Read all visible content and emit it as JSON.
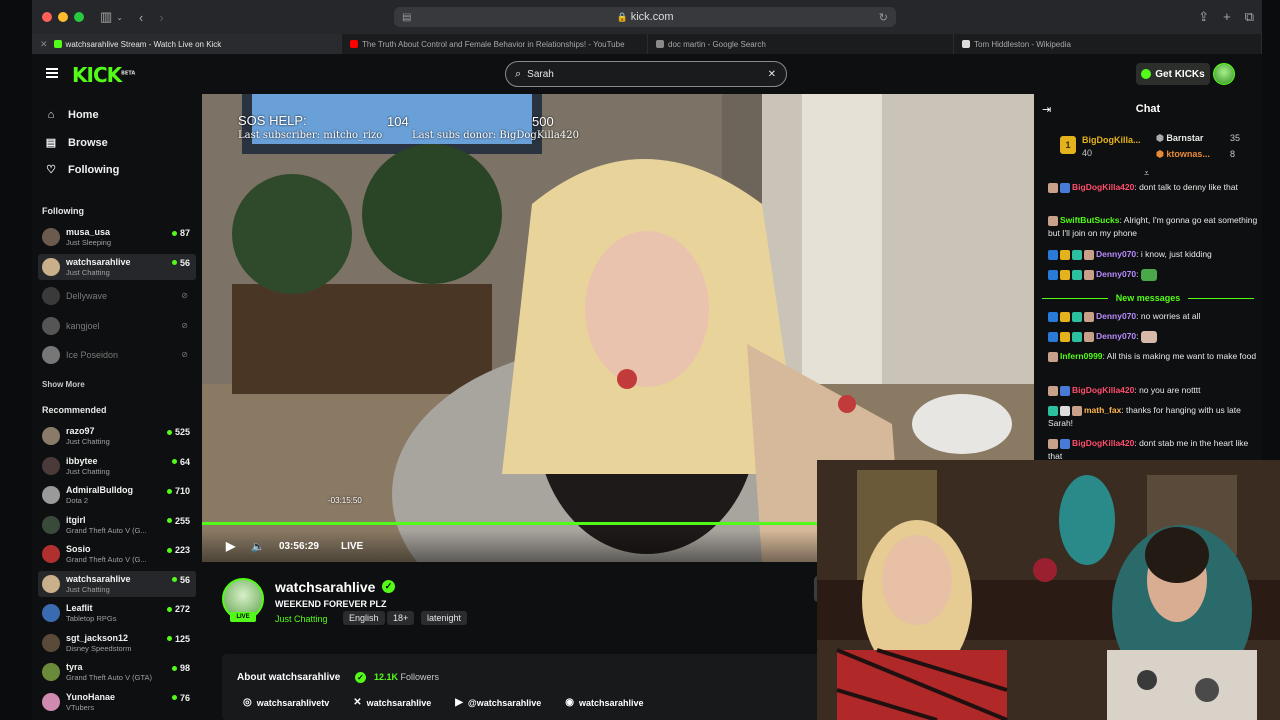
{
  "browser": {
    "url": "kick.com",
    "tabs": [
      {
        "title": "watchsarahlive Stream - Watch Live on Kick",
        "active": true,
        "fav_color": "#53fc18"
      },
      {
        "title": "The Truth About Control and Female Behavior in Relationships! - YouTube",
        "active": false,
        "fav_color": "#ff0000"
      },
      {
        "title": "doc martin - Google Search",
        "active": false,
        "fav_color": "#8a8a8a"
      },
      {
        "title": "Tom Hiddleston - Wikipedia",
        "active": false,
        "fav_color": "#dddddd"
      }
    ]
  },
  "header": {
    "logo": "KICK",
    "logo_sup": "BETA",
    "search_value": "Sarah",
    "get_kicks": "Get KICKs"
  },
  "nav": {
    "home": "Home",
    "browse": "Browse",
    "following": "Following"
  },
  "following": {
    "title": "Following",
    "channels": [
      {
        "name": "musa_usa",
        "sub": "Just Sleeping",
        "viewers": "87",
        "live": true,
        "active": false,
        "av": "#6b5a4e"
      },
      {
        "name": "watchsarahlive",
        "sub": "Just Chatting",
        "viewers": "56",
        "live": true,
        "active": true,
        "av": "#c9b08a"
      },
      {
        "name": "Dellywave",
        "sub": "",
        "viewers": "",
        "live": false,
        "active": false,
        "av": "#3a3a3a"
      },
      {
        "name": "kangjoel",
        "sub": "",
        "viewers": "",
        "live": false,
        "active": false,
        "av": "#555555"
      },
      {
        "name": "Ice Poseidon",
        "sub": "",
        "viewers": "",
        "live": false,
        "active": false,
        "av": "#777777"
      }
    ],
    "show_more": "Show More"
  },
  "recommended": {
    "title": "Recommended",
    "channels": [
      {
        "name": "razo97",
        "sub": "Just Chatting",
        "viewers": "525",
        "active": false,
        "av": "#8a7a6a"
      },
      {
        "name": "ibbytee",
        "sub": "Just Chatting",
        "viewers": "64",
        "active": false,
        "av": "#4a3a3a"
      },
      {
        "name": "AdmiralBulldog",
        "sub": "Dota 2",
        "viewers": "710",
        "active": false,
        "av": "#9a9a9a"
      },
      {
        "name": "itgirl",
        "sub": "Grand Theft Auto V (G...",
        "viewers": "255",
        "active": false,
        "av": "#3a4a3a"
      },
      {
        "name": "Sosio",
        "sub": "Grand Theft Auto V (G...",
        "viewers": "223",
        "active": false,
        "av": "#b03030"
      },
      {
        "name": "watchsarahlive",
        "sub": "Just Chatting",
        "viewers": "56",
        "active": true,
        "av": "#c9b08a"
      },
      {
        "name": "Leaflit",
        "sub": "Tabletop RPGs",
        "viewers": "272",
        "active": false,
        "av": "#3a6ab0"
      },
      {
        "name": "sgt_jackson12",
        "sub": "Disney Speedstorm",
        "viewers": "125",
        "active": false,
        "av": "#5a4a3a"
      },
      {
        "name": "tyra",
        "sub": "Grand Theft Auto V (GTA)",
        "viewers": "98",
        "active": false,
        "av": "#6a8a3a"
      },
      {
        "name": "YunoHanae",
        "sub": "VTubers",
        "viewers": "76",
        "active": false,
        "av": "#d08ab0"
      }
    ]
  },
  "video": {
    "overlay_sos": "SOS HELP:",
    "overlay_count": "104",
    "overlay_goal": "500",
    "overlay_last_sub": "Last subscriber: mitcho_rizo",
    "overlay_last_donor": "Last subs donor: BigDogKilla420",
    "progress_hover_time": "-03:15:50",
    "elapsed": "03:56:29",
    "live_label": "LIVE",
    "progress_percent": 100
  },
  "stream": {
    "name": "watchsarahlive",
    "title": "WEEKEND FOREVER PLZ",
    "category": "Just Chatting",
    "tags": [
      "English",
      "18+",
      "latenight"
    ],
    "live_badge": "LIVE"
  },
  "about": {
    "title": "About watchsarahlive",
    "followers_count": "12.1K",
    "followers_label": "Followers",
    "socials": [
      {
        "icon": "instagram-icon",
        "glyph": "◎",
        "label": "watchsarahlivetv"
      },
      {
        "icon": "x-twitter-icon",
        "glyph": "✕",
        "label": "watchsarahlive"
      },
      {
        "icon": "youtube-icon",
        "glyph": "▶",
        "label": "@watchsarahlive"
      },
      {
        "icon": "discord-icon",
        "glyph": "◉",
        "label": "watchsarahlive"
      }
    ]
  },
  "chat": {
    "title": "Chat",
    "leaderboard": {
      "first_name": "BigDogKilla...",
      "first_value": "40",
      "second_name": "Barnstar",
      "second_value": "35",
      "third_name": "ktownas...",
      "third_value": "8",
      "rank": "1"
    },
    "new_messages_label": "New messages",
    "messages": [
      {
        "user": "BigDogKilla420",
        "color": "#ff4d6d",
        "text": ": dont talk to denny like that"
      },
      {
        "user": "SwiftButSucks",
        "color": "#53fc18",
        "text": ": Alright, I'm gonna go eat something but I'll join on my phone"
      },
      {
        "user": "Denny070",
        "color": "#b98cff",
        "text": ": i know, just kidding"
      },
      {
        "user": "Denny070",
        "color": "#b98cff",
        "text": ": "
      },
      {
        "user": "Denny070",
        "color": "#b98cff",
        "text": ": no worries at all"
      },
      {
        "user": "Denny070",
        "color": "#b98cff",
        "text": ": "
      },
      {
        "user": "Infern0999",
        "color": "#53fc18",
        "text": ": All this is making me want to make food"
      },
      {
        "user": "BigDogKilla420",
        "color": "#ff4d6d",
        "text": ": no you are notttt"
      },
      {
        "user": "math_fax",
        "color": "#ffb84d",
        "text": ": thanks for hanging with us late Sarah!"
      },
      {
        "user": "BigDogKilla420",
        "color": "#ff4d6d",
        "text": ": dont stab me in the heart like that"
      }
    ]
  },
  "colors": {
    "accent": "#53fc18",
    "background": "#0e0f10"
  }
}
